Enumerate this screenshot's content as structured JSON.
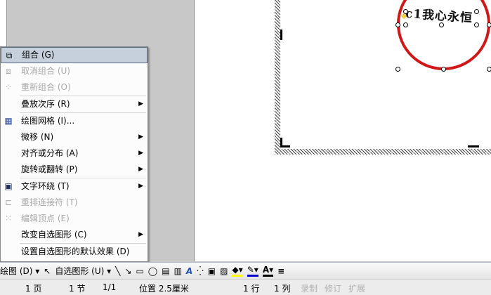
{
  "document": {
    "wordart_text": "c1我心永恒"
  },
  "context_menu": {
    "items": [
      {
        "label": "组合 (G)",
        "icon": "group-icon",
        "enabled": true,
        "selected": true
      },
      {
        "label": "取消组合 (U)",
        "icon": "ungroup-icon",
        "enabled": false
      },
      {
        "label": "重新组合 (O)",
        "icon": "regroup-icon",
        "enabled": false
      },
      {
        "label": "叠放次序 (R)",
        "enabled": true,
        "submenu": true
      },
      {
        "label": "绘图网格 (I)...",
        "icon": "grid-icon",
        "enabled": true
      },
      {
        "label": "微移 (N)",
        "enabled": true,
        "submenu": true
      },
      {
        "label": "对齐或分布 (A)",
        "enabled": true,
        "submenu": true
      },
      {
        "label": "旋转或翻转 (P)",
        "enabled": true,
        "submenu": true
      },
      {
        "label": "文字环绕 (T)",
        "icon": "text-wrap-icon",
        "enabled": true,
        "submenu": true
      },
      {
        "label": "重排连接符 (T)",
        "icon": "reroute-connectors-icon",
        "enabled": false
      },
      {
        "label": "编辑顶点 (E)",
        "icon": "edit-points-icon",
        "enabled": false
      },
      {
        "label": "改变自选图形 (C)",
        "enabled": true,
        "submenu": true
      },
      {
        "label": "设置自选图形的默认效果 (D)",
        "enabled": true
      }
    ]
  },
  "drawing_toolbar": {
    "draw_label": "绘图 (D) ▾",
    "autoshapes_label": "自选图形 (U) ▾"
  },
  "status_bar": {
    "page": "1 页",
    "section": "1 节",
    "pages": "1/1",
    "position": "位置 2.5厘米",
    "line": "1 行",
    "column": "1 列",
    "rec": "录制",
    "trk": "修订",
    "ext": "扩展"
  },
  "colors": {
    "circle": "#d01818",
    "fill": "#ffff00",
    "line": "#0000cc",
    "font": "#000000"
  }
}
